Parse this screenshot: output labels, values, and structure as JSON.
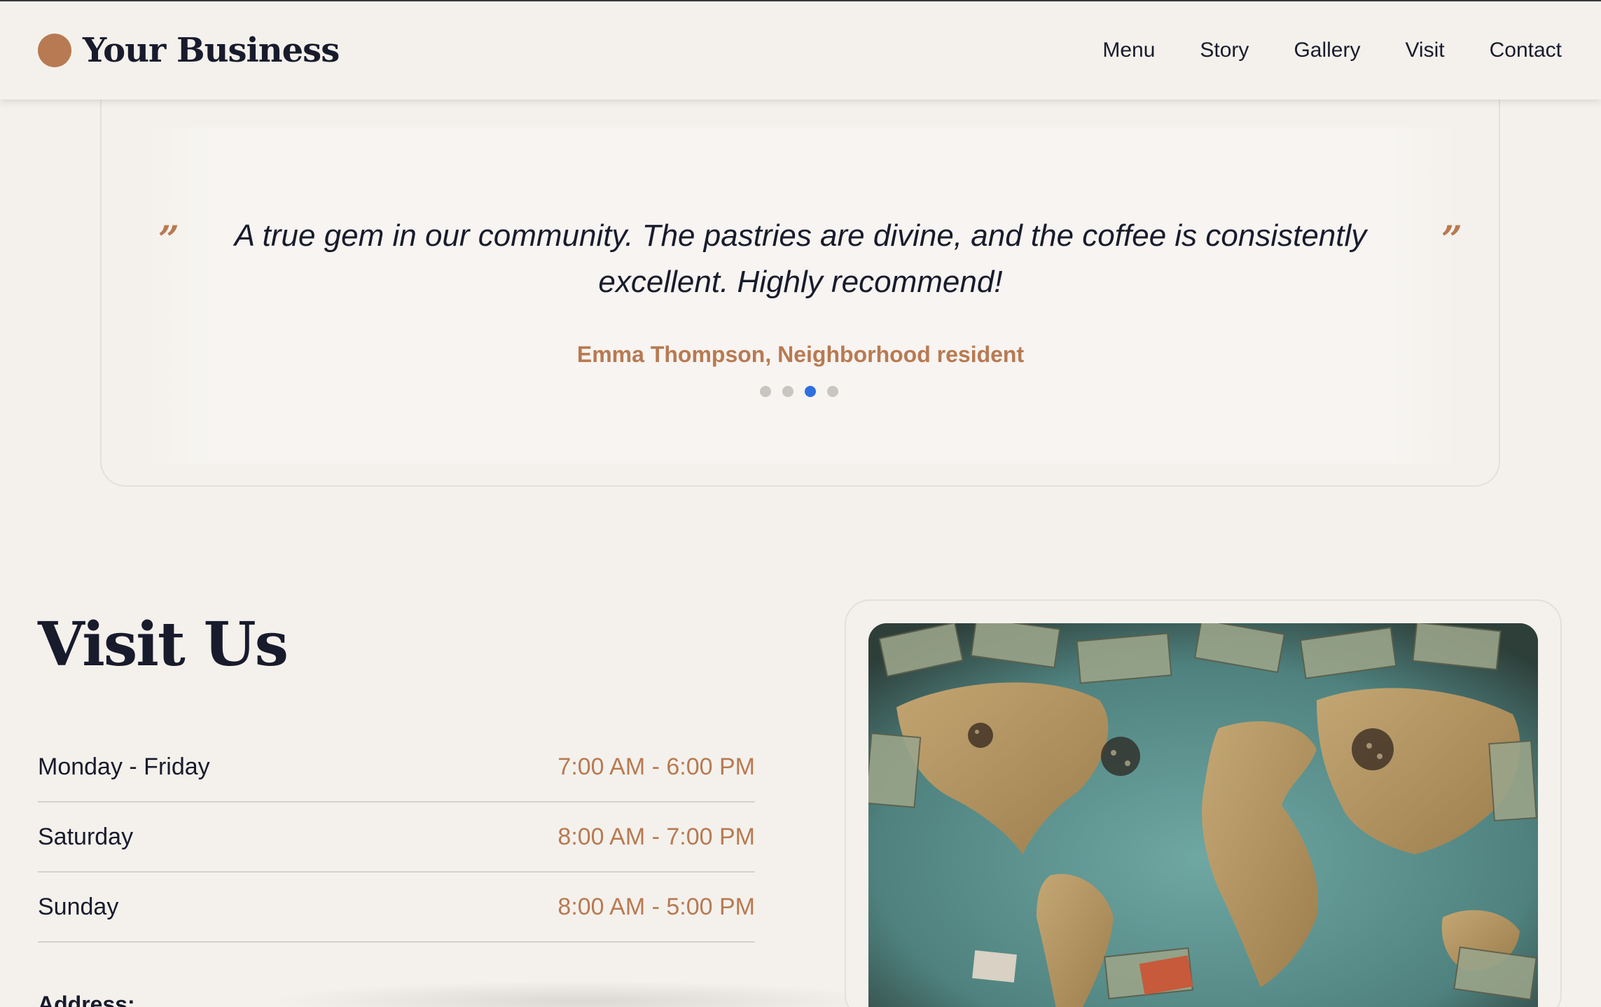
{
  "header": {
    "brand_name": "Your Business",
    "nav": [
      "Menu",
      "Story",
      "Gallery",
      "Visit",
      "Contact"
    ]
  },
  "testimonial": {
    "open_quote": "”",
    "close_quote": "”",
    "text": "A true gem in our community. The pastries are divine, and the coffee is consistently excellent. Highly recommend!",
    "author": "Emma Thompson, Neighborhood resident",
    "slides": 4,
    "active_slide": 3
  },
  "visit": {
    "title": "Visit Us",
    "hours": [
      {
        "day": "Monday - Friday",
        "time": "7:00 AM - 6:00 PM"
      },
      {
        "day": "Saturday",
        "time": "8:00 AM - 7:00 PM"
      },
      {
        "day": "Sunday",
        "time": "8:00 AM - 5:00 PM"
      }
    ],
    "address_label": "Address:"
  },
  "colors": {
    "background": "#f4f1ec",
    "accent": "#b87a52",
    "text": "#181b2c",
    "active_dot": "#2f6fe0"
  }
}
